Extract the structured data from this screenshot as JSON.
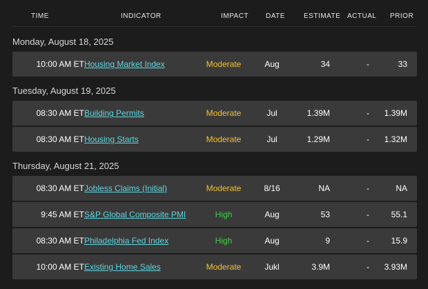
{
  "header": {
    "time": "TIME",
    "indicator": "INDICATOR",
    "impact": "IMPACT",
    "date": "DATE",
    "estimate": "ESTIMATE",
    "actual": "ACTUAL",
    "prior": "PRIOR"
  },
  "colors": {
    "moderate": "#f2c233",
    "high": "#3fcf45",
    "link": "#5ed6df",
    "row_bg": "#3a3a3a",
    "page_bg": "#1c1c1c"
  },
  "groups": [
    {
      "date": "Monday, August 18, 2025",
      "rows": [
        {
          "time": "10:00 AM ET",
          "indicator": "Housing Market Index",
          "impact": "Moderate",
          "date": "Aug",
          "estimate": "34",
          "actual": "-",
          "prior": "33"
        }
      ]
    },
    {
      "date": "Tuesday, August 19, 2025",
      "rows": [
        {
          "time": "08:30 AM ET",
          "indicator": "Building Permits",
          "impact": "Moderate",
          "date": "Jul",
          "estimate": "1.39M",
          "actual": "-",
          "prior": "1.39M"
        },
        {
          "time": "08:30 AM ET",
          "indicator": "Housing Starts",
          "impact": "Moderate",
          "date": "Jul",
          "estimate": "1.29M",
          "actual": "-",
          "prior": "1.32M"
        }
      ]
    },
    {
      "date": "Thursday, August 21, 2025",
      "rows": [
        {
          "time": "08:30 AM ET",
          "indicator": "Jobless Claims (Initial)",
          "impact": "Moderate",
          "date": "8/16",
          "estimate": "NA",
          "actual": "-",
          "prior": "NA"
        },
        {
          "time": "9:45 AM ET",
          "indicator": "S&P Global Composite PMI",
          "impact": "High",
          "date": "Aug",
          "estimate": "53",
          "actual": "-",
          "prior": "55.1"
        },
        {
          "time": "08:30 AM ET",
          "indicator": "Philadelphia Fed Index",
          "impact": "High",
          "date": "Aug",
          "estimate": "9",
          "actual": "-",
          "prior": "15.9"
        },
        {
          "time": "10:00 AM ET",
          "indicator": "Existing Home Sales",
          "impact": "Moderate",
          "date": "Jukl",
          "estimate": "3.9M",
          "actual": "-",
          "prior": "3.93M"
        }
      ]
    }
  ]
}
